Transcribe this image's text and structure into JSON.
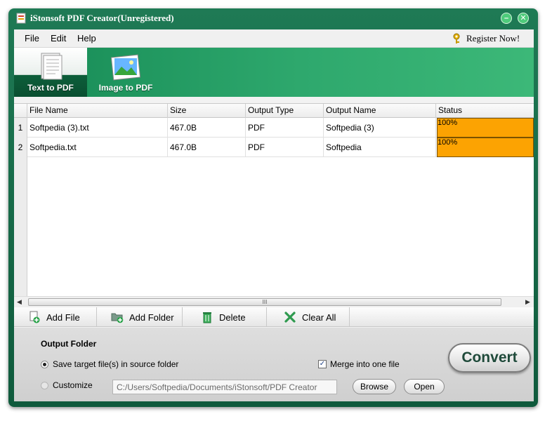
{
  "window": {
    "title": "iStonsoft PDF Creator(Unregistered)"
  },
  "menu": {
    "file": "File",
    "edit": "Edit",
    "help": "Help",
    "register": "Register Now!"
  },
  "tabs": [
    {
      "label": "Text to PDF",
      "icon": "text-document-icon",
      "active": true
    },
    {
      "label": "Image to PDF",
      "icon": "image-icon",
      "active": false
    }
  ],
  "table": {
    "columns": [
      "File Name",
      "Size",
      "Output Type",
      "Output Name",
      "Status"
    ],
    "rows": [
      {
        "num": "1",
        "file_name": "Softpedia (3).txt",
        "size": "467.0B",
        "output_type": "PDF",
        "output_name": "Softpedia (3)",
        "status": "100%",
        "progress": 1.0
      },
      {
        "num": "2",
        "file_name": "Softpedia.txt",
        "size": "467.0B",
        "output_type": "PDF",
        "output_name": "Softpedia",
        "status": "100%",
        "progress": 1.0
      }
    ]
  },
  "scrollbar": {
    "grip": "III"
  },
  "actions": {
    "add_file": "Add File",
    "add_folder": "Add Folder",
    "delete": "Delete",
    "clear_all": "Clear All"
  },
  "output": {
    "title": "Output Folder",
    "save_source_label": "Save target file(s) in source folder",
    "save_source_selected": true,
    "customize_label": "Customize",
    "customize_selected": false,
    "path": "C:/Users/Softpedia/Documents/iStonsoft/PDF Creator",
    "merge_label": "Merge into one file",
    "merge_checked": true,
    "browse_label": "Browse",
    "open_label": "Open",
    "convert_label": "Convert"
  },
  "colors": {
    "frame": "#1f7a55",
    "status_fill": "#fca302",
    "toolbar": "#2ea86d"
  }
}
